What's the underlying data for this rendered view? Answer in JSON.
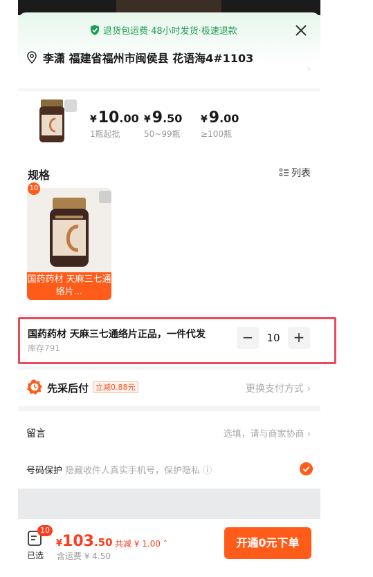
{
  "banner": {
    "text": "退货包运费·48小时发货·极速退款"
  },
  "address": {
    "text": "李潇 福建省福州市闽侯县 花语海4#1103"
  },
  "price_tiers": [
    {
      "yen": "¥",
      "int": "10",
      "dec": ".00",
      "cond": "1瓶起批"
    },
    {
      "yen": "¥",
      "int": "9",
      "dec": ".50",
      "cond": "50~99瓶"
    },
    {
      "yen": "¥",
      "int": "9",
      "dec": ".00",
      "cond": "≥100瓶"
    }
  ],
  "spec": {
    "title": "规格",
    "list_label": "列表",
    "badge": "10",
    "card_name": "国药药材 天麻三七通络片..."
  },
  "sku": {
    "name": "国药药材 天麻三七通络片正品，一件代发",
    "stock": "库存791",
    "minus": "−",
    "qty": "10",
    "plus": "+"
  },
  "payment": {
    "label": "先采后付",
    "discount": "立减0.88元",
    "change": "更换支付方式"
  },
  "message": {
    "label": "留言",
    "placeholder": "选填，请与商家协商"
  },
  "protection": {
    "label": "号码保护",
    "desc": "隐藏收件人真实手机号，保护隐私",
    "checked": true
  },
  "footer": {
    "cart_badge": "10",
    "selected": "已选",
    "yen": "¥",
    "total_int": "103",
    "total_dec": ".50",
    "saved": "共减 ¥ 1.00",
    "shipping": "含运费 ¥ 4.50",
    "order_button": "开通0元下单"
  },
  "colors": {
    "accent": "#ff5c1a",
    "green": "#1f9d55",
    "price_red": "#ff3b1a",
    "highlight": "#ea4a5a"
  }
}
